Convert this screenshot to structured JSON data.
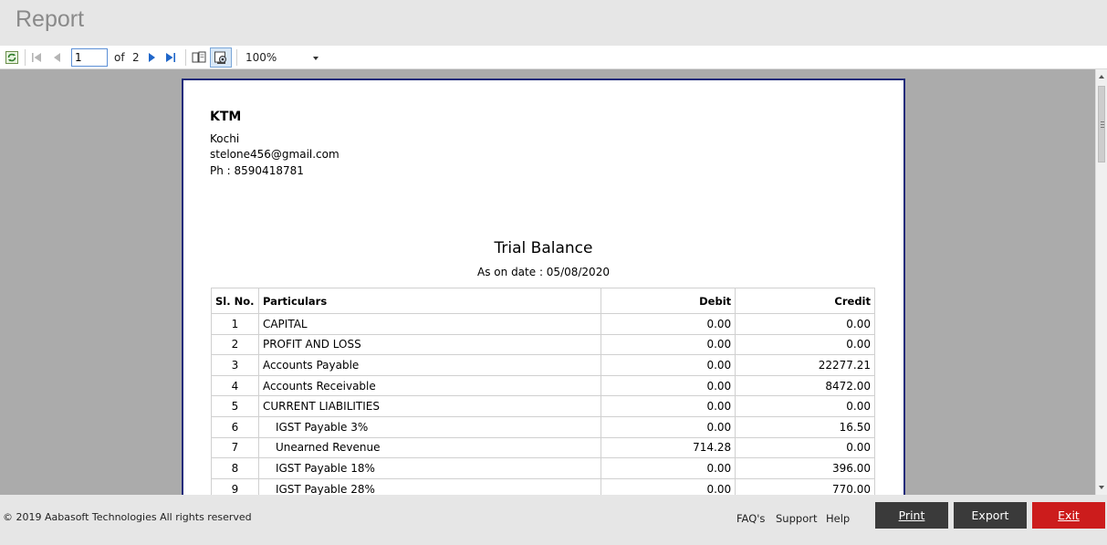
{
  "window": {
    "title": "Report"
  },
  "toolbar": {
    "current_page": "1",
    "of_label": "of",
    "total_pages": "2",
    "zoom": "100%"
  },
  "report": {
    "company": "KTM",
    "address_lines": [
      "Kochi",
      "stelone456@gmail.com",
      "Ph : 8590418781"
    ],
    "title": "Trial Balance",
    "subtitle": "As on date : 05/08/2020",
    "columns": [
      "Sl. No.",
      "Particulars",
      "Debit",
      "Credit"
    ],
    "rows": [
      [
        "1",
        "CAPITAL",
        "0.00",
        "0.00"
      ],
      [
        "2",
        "PROFIT AND LOSS",
        "0.00",
        "0.00"
      ],
      [
        "3",
        "Accounts Payable",
        "0.00",
        "22277.21"
      ],
      [
        "4",
        "Accounts Receivable",
        "0.00",
        "8472.00"
      ],
      [
        "5",
        "CURRENT LIABILITIES",
        "0.00",
        "0.00"
      ],
      [
        "6",
        "IGST Payable 3%",
        "0.00",
        "16.50"
      ],
      [
        "7",
        "Unearned Revenue",
        "714.28",
        "0.00"
      ],
      [
        "8",
        "IGST Payable 18%",
        "0.00",
        "396.00"
      ],
      [
        "9",
        "IGST Payable 28%",
        "0.00",
        "770.00"
      ]
    ]
  },
  "footer": {
    "copyright": "© 2019 Aabasoft Technologies All rights reserved",
    "links": [
      "FAQ's",
      "Support",
      "Help"
    ],
    "print_label": "Print",
    "export_label": "Export",
    "exit_label": "Exit"
  },
  "colors": {
    "exit_button": "#cc1c1c",
    "dark_button": "#3a3a3a",
    "page_border": "#1d2a7a",
    "viewer_bg": "#ababab"
  }
}
